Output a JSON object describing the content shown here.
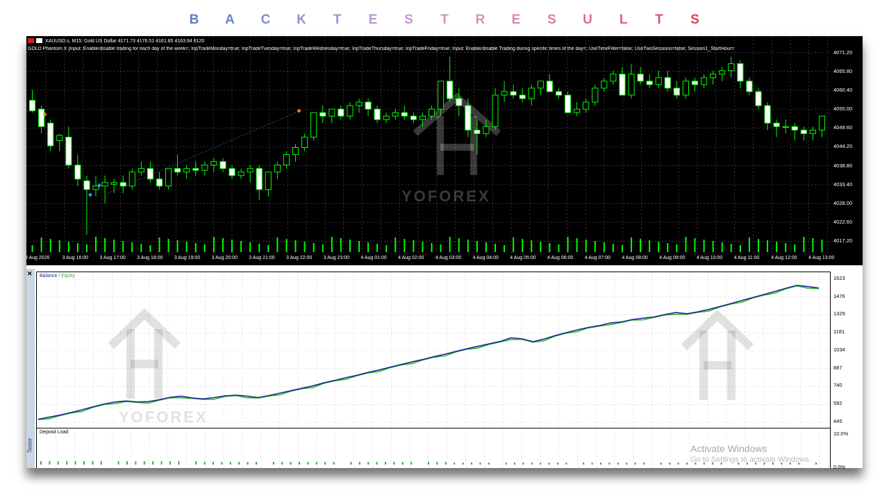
{
  "banner": {
    "letters": [
      "B",
      "A",
      "C",
      "K",
      "T",
      "E",
      "S",
      "T",
      "R",
      "E",
      "S",
      "U",
      "L",
      "T",
      "S"
    ],
    "colors": [
      "#5b7fc4",
      "#6d86c9",
      "#7f8ccd",
      "#9190cf",
      "#a395d0",
      "#b497d0",
      "#c298cf",
      "#ce97cb",
      "#d690c2",
      "#dc86b6",
      "#e07aa7",
      "#e26c95",
      "#e35d82",
      "#e44d6e",
      "#e53d5a"
    ]
  },
  "chart": {
    "title": "XAUUSD.s, M15:  Gold US Dollar  4171.73 4176.51 4161.85 4163.94  6120",
    "params": "GOLD Phantom X [Input: Enable/disable trading for each day of the week=; InpTradeMonday=true; InpTradeTuesday=true; InpTradeWednesday=true; InpTradeThursday=true; InpTradeFriday=true; Input: Enable/disable Trading during specific times of the day=; UseTimeFilter=false; UseTwoSessions=false; Session1_StartHour=",
    "price_labels": [
      "4071.20",
      "4065.80",
      "4060.40",
      "4055.00",
      "4049.60",
      "4044.20",
      "4038.80",
      "4033.40",
      "4028.00",
      "4022.60",
      "4017.20"
    ],
    "time_labels": [
      "3 Aug 2026",
      "3 Aug 16:00",
      "3 Aug 17:00",
      "3 Aug 18:00",
      "3 Aug 19:00",
      "3 Aug 20:00",
      "3 Aug 21:00",
      "3 Aug 22:00",
      "3 Aug 23:00",
      "4 Aug 01:00",
      "4 Aug 02:00",
      "4 Aug 03:00",
      "4 Aug 04:00",
      "4 Aug 05:00",
      "4 Aug 06:00",
      "4 Aug 07:00",
      "4 Aug 08:00",
      "4 Aug 09:00",
      "4 Aug 10:00",
      "4 Aug 11:00",
      "4 Aug 12:00",
      "4 Aug 13:00"
    ],
    "candles": [
      [
        4057.5,
        4060.5,
        4054,
        4054.5
      ],
      [
        4055,
        4056,
        4048,
        4050
      ],
      [
        4051,
        4052,
        4043,
        4044.5
      ],
      [
        4046,
        4048,
        4043,
        4047.5
      ],
      [
        4047,
        4050,
        4038,
        4039
      ],
      [
        4039,
        4042,
        4033,
        4035
      ],
      [
        4034.5,
        4036,
        4019,
        4032
      ],
      [
        4032,
        4036,
        4030,
        4033
      ],
      [
        4033,
        4036,
        4028,
        4034
      ],
      [
        4033.5,
        4035,
        4031,
        4034
      ],
      [
        4034,
        4036,
        4031,
        4033
      ],
      [
        4033,
        4038,
        4032,
        4037
      ],
      [
        4037,
        4040,
        4036,
        4038
      ],
      [
        4038,
        4040,
        4034,
        4035
      ],
      [
        4035,
        4037,
        4032,
        4033
      ],
      [
        4033,
        4038,
        4032,
        4038
      ],
      [
        4038,
        4042,
        4036,
        4037
      ],
      [
        4037,
        4039,
        4035,
        4038
      ],
      [
        4038,
        4040,
        4036,
        4037.5
      ],
      [
        4037.5,
        4040,
        4036,
        4039
      ],
      [
        4039,
        4041,
        4037,
        4040
      ],
      [
        4040,
        4041,
        4037,
        4038
      ],
      [
        4038,
        4039,
        4035,
        4036
      ],
      [
        4036,
        4038,
        4035,
        4037
      ],
      [
        4037,
        4039,
        4034,
        4038
      ],
      [
        4038,
        4039,
        4029,
        4032
      ],
      [
        4032,
        4035,
        4030,
        4037
      ],
      [
        4037,
        4040,
        4035,
        4039
      ],
      [
        4039,
        4043,
        4038,
        4042
      ],
      [
        4042,
        4045,
        4040,
        4044
      ],
      [
        4044,
        4048,
        4043,
        4047
      ],
      [
        4047,
        4052,
        4046,
        4054
      ],
      [
        4054,
        4056,
        4051,
        4053
      ],
      [
        4053,
        4055,
        4051,
        4055
      ],
      [
        4055,
        4056,
        4052,
        4053
      ],
      [
        4053,
        4057,
        4052,
        4056
      ],
      [
        4056,
        4058,
        4054,
        4057
      ],
      [
        4057,
        4058,
        4053,
        4055
      ],
      [
        4055,
        4056,
        4051,
        4052
      ],
      [
        4052,
        4054,
        4051,
        4053
      ],
      [
        4053,
        4055,
        4052,
        4054
      ],
      [
        4054,
        4056,
        4052,
        4053
      ],
      [
        4053,
        4054,
        4051,
        4052
      ],
      [
        4052,
        4054,
        4050,
        4053
      ],
      [
        4053,
        4056,
        4052,
        4055
      ],
      [
        4055,
        4060,
        4053,
        4063
      ],
      [
        4063,
        4070,
        4057,
        4058
      ],
      [
        4058,
        4061,
        4053,
        4056
      ],
      [
        4056,
        4058,
        4047,
        4049
      ],
      [
        4049,
        4052,
        4042,
        4048
      ],
      [
        4048,
        4052,
        4047,
        4050
      ],
      [
        4050,
        4061,
        4049,
        4059
      ],
      [
        4059,
        4063,
        4057,
        4060
      ],
      [
        4060,
        4062,
        4058,
        4059
      ],
      [
        4059,
        4061,
        4057,
        4058
      ],
      [
        4058,
        4062,
        4056,
        4061
      ],
      [
        4061,
        4063,
        4059,
        4063
      ],
      [
        4063,
        4065,
        4060,
        4060
      ],
      [
        4060,
        4061,
        4058,
        4059
      ],
      [
        4059,
        4060,
        4055,
        4054
      ],
      [
        4054,
        4057,
        4053,
        4055
      ],
      [
        4055,
        4058,
        4054,
        4057
      ],
      [
        4057,
        4062,
        4056,
        4061
      ],
      [
        4061,
        4064,
        4060,
        4063
      ],
      [
        4063,
        4066,
        4062,
        4065
      ],
      [
        4065,
        4067,
        4060,
        4059
      ],
      [
        4059,
        4068,
        4058,
        4065
      ],
      [
        4065,
        4067,
        4062,
        4063
      ],
      [
        4063,
        4065,
        4061,
        4062
      ],
      [
        4062,
        4066,
        4061,
        4064
      ],
      [
        4064,
        4066,
        4060,
        4061
      ],
      [
        4061,
        4063,
        4058,
        4059
      ],
      [
        4059,
        4064,
        4058,
        4063
      ],
      [
        4063,
        4064,
        4060,
        4062
      ],
      [
        4062,
        4065,
        4061,
        4064
      ],
      [
        4064,
        4066,
        4062,
        4065
      ],
      [
        4065,
        4067,
        4063,
        4066
      ],
      [
        4066,
        4070,
        4064,
        4068
      ],
      [
        4068,
        4069,
        4061,
        4063
      ],
      [
        4063,
        4064,
        4059,
        4060
      ],
      [
        4060,
        4061,
        4055,
        4056
      ],
      [
        4056,
        4057,
        4049,
        4051
      ],
      [
        4051,
        4052,
        4047,
        4050
      ],
      [
        4050,
        4052,
        4048,
        4050
      ],
      [
        4050,
        4051,
        4046,
        4049
      ],
      [
        4049,
        4050,
        4046,
        4048
      ],
      [
        4048,
        4050,
        4046,
        4049
      ],
      [
        4049,
        4053,
        4047,
        4053
      ]
    ],
    "watermark": "YOFOREX"
  },
  "tester": {
    "panel_label": "Tester",
    "balance_legend": "Balance",
    "equity_legend": "Equity",
    "balance_color": "#1b2a8c",
    "equity_color": "#2fb82f",
    "balance_scale": [
      "1623",
      "1476",
      "1329",
      "1181",
      "1034",
      "887",
      "740",
      "592",
      "445"
    ],
    "deposit_title": "Deposit Load",
    "deposit_scale": [
      "10.0%",
      "0.0%"
    ],
    "watermark": "YOFOREX",
    "balance_series": [
      470,
      487,
      504,
      525,
      548,
      572,
      595,
      612,
      620,
      612,
      615,
      630,
      650,
      660,
      645,
      637,
      648,
      662,
      668,
      660,
      648,
      665,
      685,
      705,
      725,
      745,
      770,
      790,
      812,
      832,
      855,
      875,
      898,
      920,
      942,
      962,
      985,
      1005,
      1028,
      1050,
      1070,
      1090,
      1110,
      1140,
      1132,
      1108,
      1130,
      1158,
      1182,
      1205,
      1225,
      1240,
      1262,
      1270,
      1290,
      1302,
      1312,
      1332,
      1348,
      1338,
      1354,
      1374,
      1398,
      1422,
      1448,
      1472,
      1496,
      1522,
      1548,
      1572,
      1562,
      1550
    ]
  },
  "activate": {
    "line1": "Activate Windows",
    "line2": "Go to Settings to activate Windows."
  }
}
